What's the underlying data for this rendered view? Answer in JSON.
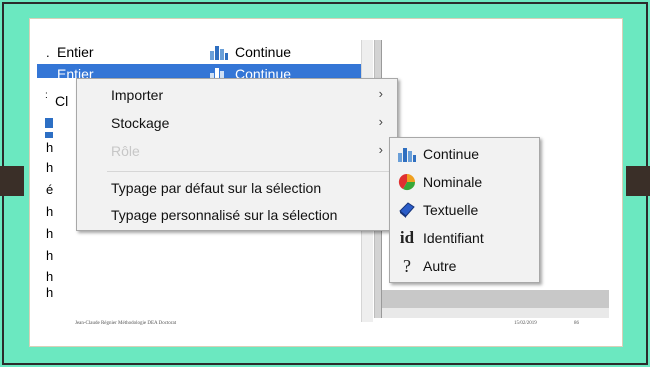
{
  "rows": [
    {
      "type": "Entier",
      "nature": "Continue",
      "selected": false
    },
    {
      "type": "Entier",
      "nature": "Continue",
      "selected": true
    }
  ],
  "partial_rows": [
    "Cl",
    "h",
    "h",
    "é",
    "h",
    "h",
    "h",
    "h",
    "h"
  ],
  "context_menu": {
    "items": [
      {
        "label": "Importer",
        "has_submenu": true,
        "disabled": false
      },
      {
        "label": "Stockage",
        "has_submenu": true,
        "disabled": false
      },
      {
        "label": "Rôle",
        "has_submenu": true,
        "disabled": true
      },
      {
        "label": "Typage par défaut sur la sélection",
        "has_submenu": false,
        "disabled": false
      },
      {
        "label": "Typage personnalisé sur la sélection",
        "has_submenu": false,
        "disabled": false
      }
    ]
  },
  "submenu": {
    "items": [
      {
        "label": "Continue",
        "icon": "bar-chart-icon"
      },
      {
        "label": "Nominale",
        "icon": "pie-chart-icon"
      },
      {
        "label": "Textuelle",
        "icon": "text-shape-icon"
      },
      {
        "label": "Identifiant",
        "icon": "id-glyph-icon",
        "glyph": "id"
      },
      {
        "label": "Autre",
        "icon": "question-mark-icon",
        "glyph": "?"
      }
    ]
  },
  "footer": {
    "author": "Jean-Claude Régnier Méthodologie DEA Doctorat",
    "date": "15/02/2019",
    "page": "86"
  },
  "colors": {
    "background": "#6be8c0",
    "selection": "#3476d6",
    "menu_bg": "#f2f2f2"
  }
}
